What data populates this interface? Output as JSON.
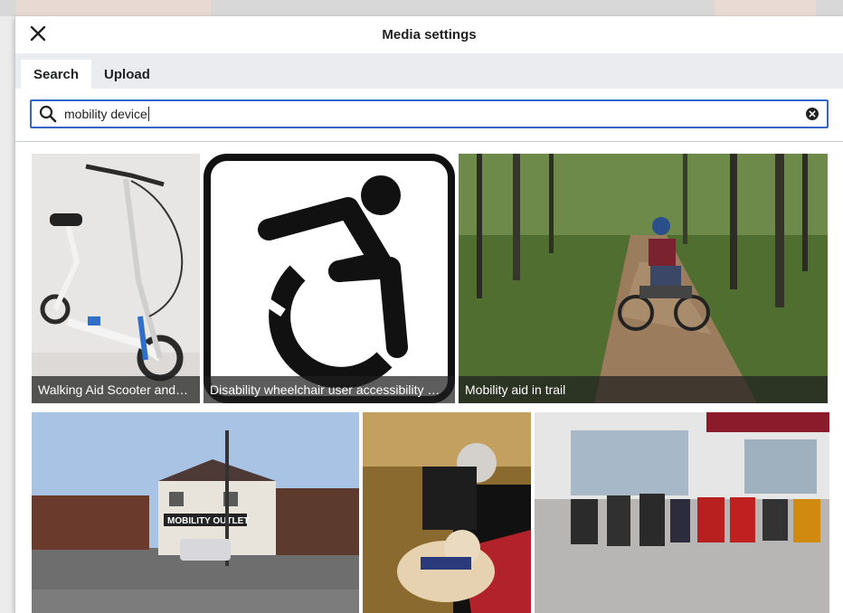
{
  "dialog": {
    "title": "Media settings",
    "close_icon": "close-icon"
  },
  "tabs": [
    {
      "label": "Search",
      "active": true
    },
    {
      "label": "Upload",
      "active": false
    }
  ],
  "search": {
    "value": "mobility device",
    "search_icon": "search-icon",
    "clear_icon": "clear-icon"
  },
  "results": [
    {
      "caption": "Walking Aid Scooter and…"
    },
    {
      "caption": "Disability wheelchair user accessibility …"
    },
    {
      "caption": "Mobility aid in trail"
    },
    {
      "caption": ""
    },
    {
      "caption": ""
    },
    {
      "caption": ""
    }
  ],
  "colors": {
    "accent": "#3366cc",
    "tab_bar": "#eaecf0",
    "caption_bg": "#1e1e1e"
  }
}
